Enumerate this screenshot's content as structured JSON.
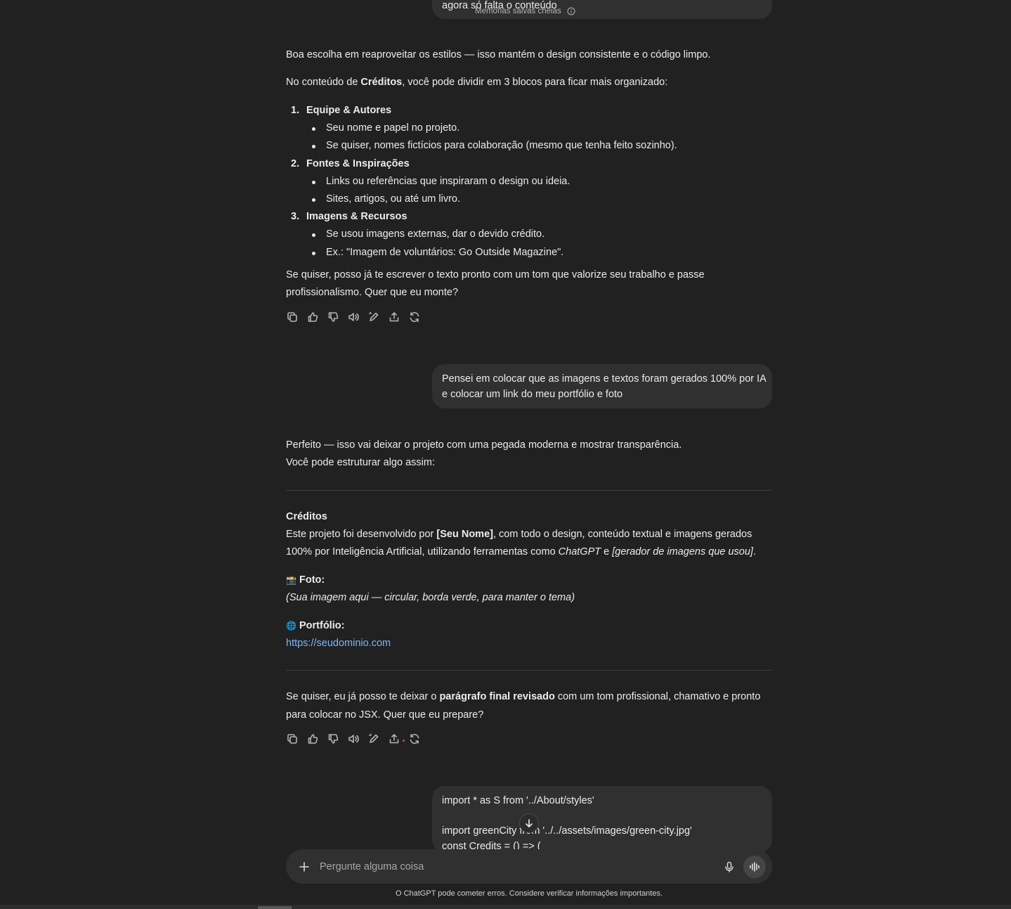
{
  "top_bubble": {
    "text": "agora só falta o conteúdo",
    "memory_label": "Memórias salvas cheias"
  },
  "msg1": {
    "p1": "Boa escolha em reaproveitar os estilos — isso mantém o design consistente e o código limpo.",
    "p2_pre": "No conteúdo de ",
    "p2_bold": "Créditos",
    "p2_post": ", você pode dividir em 3 blocos para ficar mais organizado:",
    "list": [
      {
        "num": "1.",
        "title": "Equipe & Autores",
        "items": [
          "Seu nome e papel no projeto.",
          "Se quiser, nomes fictícios para colaboração (mesmo que tenha feito sozinho)."
        ]
      },
      {
        "num": "2.",
        "title": "Fontes & Inspirações",
        "items": [
          "Links ou referências que inspiraram o design ou ideia.",
          "Sites, artigos, ou até um livro."
        ]
      },
      {
        "num": "3.",
        "title": "Imagens & Recursos",
        "items": [
          "Se usou imagens externas, dar o devido crédito.",
          "Ex.: \"Imagem de voluntários: Go Outside Magazine\"."
        ]
      }
    ],
    "closing_1": "Se quiser, posso já te escrever o texto pronto com um tom que valorize seu trabalho e passe",
    "closing_2": "profissionalismo. Quer que eu monte?"
  },
  "user2": {
    "line1": "Pensei em colocar que as imagens e textos foram gerados 100% por IA",
    "line2": "e colocar um link do meu portfólio e foto"
  },
  "msg2": {
    "p1": "Perfeito — isso vai deixar o projeto com uma pegada moderna e mostrar transparência.",
    "p2": "Você pode estruturar algo assim:",
    "credits_title": "Créditos",
    "credits_1_pre": "Este projeto foi desenvolvido por ",
    "credits_1_bold": "[Seu Nome]",
    "credits_1_post": ", com todo o design, conteúdo textual e imagens gerados",
    "credits_2_pre": "100% por Inteligência Artificial, utilizando ferramentas como ",
    "credits_2_i1": "ChatGPT",
    "credits_2_mid": " e ",
    "credits_2_i2": "[gerador de imagens que usou]",
    "credits_2_end": ".",
    "foto_emoji": "📸",
    "foto_label": "Foto:",
    "foto_desc": "(Sua imagem aqui — circular, borda verde, para manter o tema)",
    "portfolio_emoji": "🌐",
    "portfolio_label": "Portfólio:",
    "portfolio_url": "https://seudominio.com",
    "closing_1_pre": "Se quiser, eu já posso te deixar o ",
    "closing_1_bold": "parágrafo final revisado",
    "closing_1_post": " com um tom profissional, chamativo e pronto",
    "closing_2": "para colocar no JSX. Quer que eu prepare?"
  },
  "user3": {
    "line1": "import * as S from '../About/styles'",
    "line2": "import greenCity from '../../assets/images/green-city.jpg'",
    "line3": "const Credits = () => ("
  },
  "composer": {
    "placeholder": "Pergunte alguma coisa"
  },
  "footer": "O ChatGPT pode cometer erros. Considere verificar informações importantes.",
  "icons": [
    "copy-icon",
    "thumbs-up-icon",
    "thumbs-down-icon",
    "read-aloud-icon",
    "edit-icon",
    "share-icon",
    "regenerate-icon",
    "plus-icon",
    "mic-icon",
    "voice-mode-icon",
    "arrow-down-icon",
    "info-icon"
  ]
}
